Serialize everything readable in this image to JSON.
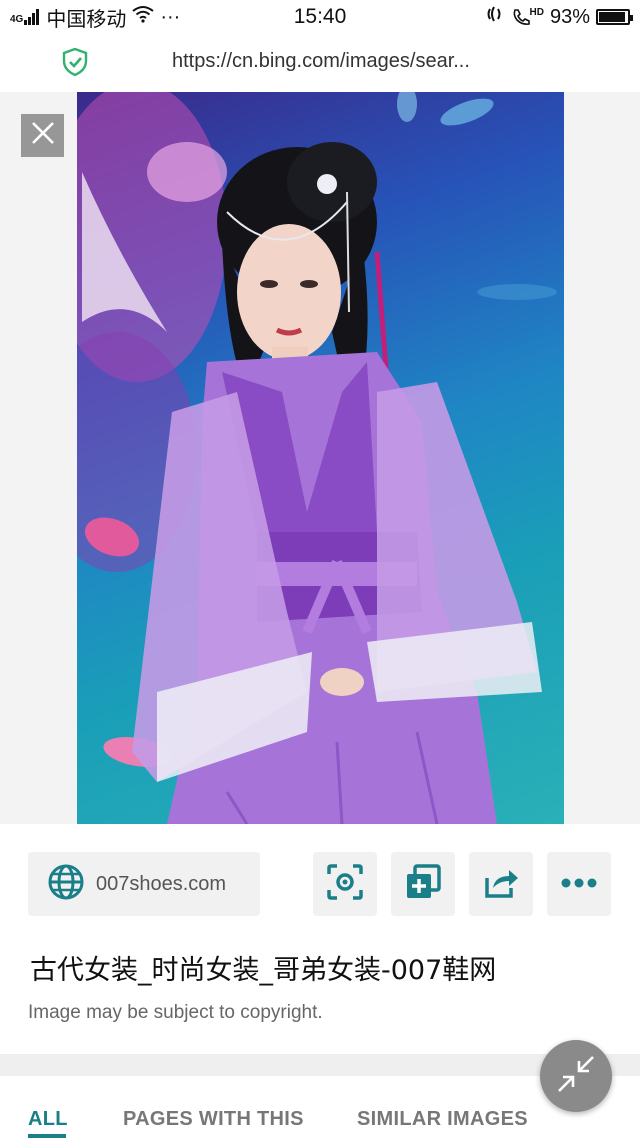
{
  "status_bar": {
    "network_type": "4G",
    "carrier": "中国移动",
    "overflow": "···",
    "time": "15:40",
    "volte": "HD",
    "battery_percent": "93%",
    "battery_level": 0.93
  },
  "browser": {
    "url": "https://cn.bing.com/images/sear..."
  },
  "viewer": {
    "close_icon": "close-icon"
  },
  "source": {
    "site": "007shoes.com",
    "icon": "globe-icon"
  },
  "actions": [
    {
      "icon": "visual-search-icon"
    },
    {
      "icon": "add-to-collection-icon"
    },
    {
      "icon": "share-icon"
    },
    {
      "icon": "more-icon"
    }
  ],
  "image_info": {
    "title": "古代女装_时尚女装_哥弟女装-007鞋网",
    "copyright": "Image may be subject to copyright."
  },
  "tabs": [
    {
      "label": "ALL",
      "active": true
    },
    {
      "label": "PAGES WITH THIS",
      "active": false
    },
    {
      "label": "SIMILAR IMAGES",
      "active": false
    }
  ],
  "colors": {
    "accent": "#1a7f88",
    "icon_teal": "#1a7f88",
    "fab": "#8a8a8a"
  }
}
